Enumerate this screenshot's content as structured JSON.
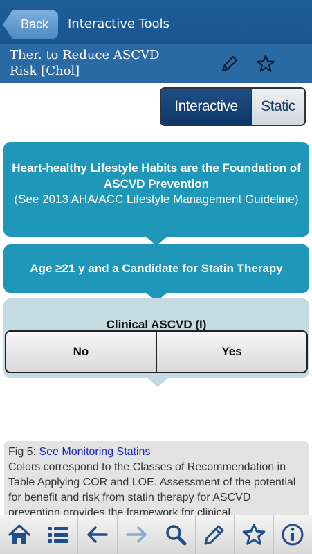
{
  "nav": {
    "back_label": "Back",
    "title": "Interactive Tools"
  },
  "document": {
    "title": "Ther. to Reduce ASCVD Risk [Chol]",
    "edit_icon": "pencil-icon",
    "favorite_icon": "star-icon"
  },
  "view_toggle": {
    "options": [
      "Interactive",
      "Static"
    ],
    "selected": "Interactive"
  },
  "flowchart": {
    "box1": {
      "heading": "Heart-healthy Lifestyle Habits are the Foundation of ASCVD Prevention",
      "subtext": "(See 2013 AHA/ACC Lifestyle Management Guideline)"
    },
    "box2": {
      "text": "Age ≥21 y and a Candidate for Statin Therapy"
    },
    "question": {
      "label": "Clinical ASCVD (I)",
      "no_label": "No",
      "yes_label": "Yes"
    }
  },
  "caption": {
    "prefix": "Fig 5: ",
    "link_text": "See Monitoring Statins",
    "body": "Colors correspond to the Classes of Recommendation in Table Applying COR and LOE. Assessment of the potential for benefit and risk from statin therapy for ASCVD prevention provides the framework for clinical"
  },
  "toolbar": {
    "icons": [
      "home-icon",
      "list-icon",
      "back-arrow-icon",
      "forward-arrow-icon",
      "search-icon",
      "pencil-icon",
      "star-icon",
      "info-icon"
    ]
  },
  "colors": {
    "navbar": "#1a5590",
    "titlebar": "#2a6aa4",
    "flow_box": "#1e97b9",
    "question_box": "#c5dbe2",
    "toolbar_icon": "#1e4f8a",
    "toolbar_icon_disabled": "#8fa9c9"
  }
}
